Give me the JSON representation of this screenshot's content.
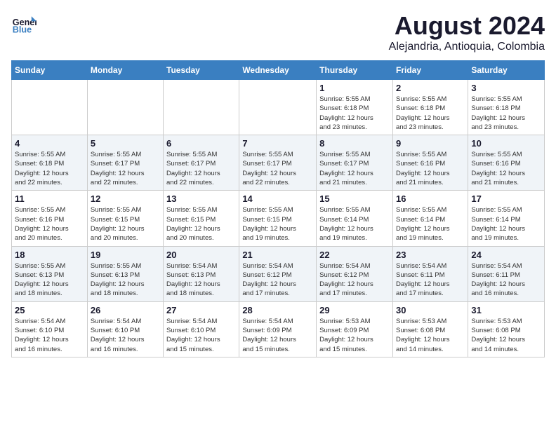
{
  "logo": {
    "text_general": "General",
    "text_blue": "Blue"
  },
  "title": "August 2024",
  "subtitle": "Alejandria, Antioquia, Colombia",
  "days_of_week": [
    "Sunday",
    "Monday",
    "Tuesday",
    "Wednesday",
    "Thursday",
    "Friday",
    "Saturday"
  ],
  "weeks": [
    [
      {
        "day": "",
        "info": ""
      },
      {
        "day": "",
        "info": ""
      },
      {
        "day": "",
        "info": ""
      },
      {
        "day": "",
        "info": ""
      },
      {
        "day": "1",
        "info": "Sunrise: 5:55 AM\nSunset: 6:18 PM\nDaylight: 12 hours\nand 23 minutes."
      },
      {
        "day": "2",
        "info": "Sunrise: 5:55 AM\nSunset: 6:18 PM\nDaylight: 12 hours\nand 23 minutes."
      },
      {
        "day": "3",
        "info": "Sunrise: 5:55 AM\nSunset: 6:18 PM\nDaylight: 12 hours\nand 23 minutes."
      }
    ],
    [
      {
        "day": "4",
        "info": "Sunrise: 5:55 AM\nSunset: 6:18 PM\nDaylight: 12 hours\nand 22 minutes."
      },
      {
        "day": "5",
        "info": "Sunrise: 5:55 AM\nSunset: 6:17 PM\nDaylight: 12 hours\nand 22 minutes."
      },
      {
        "day": "6",
        "info": "Sunrise: 5:55 AM\nSunset: 6:17 PM\nDaylight: 12 hours\nand 22 minutes."
      },
      {
        "day": "7",
        "info": "Sunrise: 5:55 AM\nSunset: 6:17 PM\nDaylight: 12 hours\nand 22 minutes."
      },
      {
        "day": "8",
        "info": "Sunrise: 5:55 AM\nSunset: 6:17 PM\nDaylight: 12 hours\nand 21 minutes."
      },
      {
        "day": "9",
        "info": "Sunrise: 5:55 AM\nSunset: 6:16 PM\nDaylight: 12 hours\nand 21 minutes."
      },
      {
        "day": "10",
        "info": "Sunrise: 5:55 AM\nSunset: 6:16 PM\nDaylight: 12 hours\nand 21 minutes."
      }
    ],
    [
      {
        "day": "11",
        "info": "Sunrise: 5:55 AM\nSunset: 6:16 PM\nDaylight: 12 hours\nand 20 minutes."
      },
      {
        "day": "12",
        "info": "Sunrise: 5:55 AM\nSunset: 6:15 PM\nDaylight: 12 hours\nand 20 minutes."
      },
      {
        "day": "13",
        "info": "Sunrise: 5:55 AM\nSunset: 6:15 PM\nDaylight: 12 hours\nand 20 minutes."
      },
      {
        "day": "14",
        "info": "Sunrise: 5:55 AM\nSunset: 6:15 PM\nDaylight: 12 hours\nand 19 minutes."
      },
      {
        "day": "15",
        "info": "Sunrise: 5:55 AM\nSunset: 6:14 PM\nDaylight: 12 hours\nand 19 minutes."
      },
      {
        "day": "16",
        "info": "Sunrise: 5:55 AM\nSunset: 6:14 PM\nDaylight: 12 hours\nand 19 minutes."
      },
      {
        "day": "17",
        "info": "Sunrise: 5:55 AM\nSunset: 6:14 PM\nDaylight: 12 hours\nand 19 minutes."
      }
    ],
    [
      {
        "day": "18",
        "info": "Sunrise: 5:55 AM\nSunset: 6:13 PM\nDaylight: 12 hours\nand 18 minutes."
      },
      {
        "day": "19",
        "info": "Sunrise: 5:55 AM\nSunset: 6:13 PM\nDaylight: 12 hours\nand 18 minutes."
      },
      {
        "day": "20",
        "info": "Sunrise: 5:54 AM\nSunset: 6:13 PM\nDaylight: 12 hours\nand 18 minutes."
      },
      {
        "day": "21",
        "info": "Sunrise: 5:54 AM\nSunset: 6:12 PM\nDaylight: 12 hours\nand 17 minutes."
      },
      {
        "day": "22",
        "info": "Sunrise: 5:54 AM\nSunset: 6:12 PM\nDaylight: 12 hours\nand 17 minutes."
      },
      {
        "day": "23",
        "info": "Sunrise: 5:54 AM\nSunset: 6:11 PM\nDaylight: 12 hours\nand 17 minutes."
      },
      {
        "day": "24",
        "info": "Sunrise: 5:54 AM\nSunset: 6:11 PM\nDaylight: 12 hours\nand 16 minutes."
      }
    ],
    [
      {
        "day": "25",
        "info": "Sunrise: 5:54 AM\nSunset: 6:10 PM\nDaylight: 12 hours\nand 16 minutes."
      },
      {
        "day": "26",
        "info": "Sunrise: 5:54 AM\nSunset: 6:10 PM\nDaylight: 12 hours\nand 16 minutes."
      },
      {
        "day": "27",
        "info": "Sunrise: 5:54 AM\nSunset: 6:10 PM\nDaylight: 12 hours\nand 15 minutes."
      },
      {
        "day": "28",
        "info": "Sunrise: 5:54 AM\nSunset: 6:09 PM\nDaylight: 12 hours\nand 15 minutes."
      },
      {
        "day": "29",
        "info": "Sunrise: 5:53 AM\nSunset: 6:09 PM\nDaylight: 12 hours\nand 15 minutes."
      },
      {
        "day": "30",
        "info": "Sunrise: 5:53 AM\nSunset: 6:08 PM\nDaylight: 12 hours\nand 14 minutes."
      },
      {
        "day": "31",
        "info": "Sunrise: 5:53 AM\nSunset: 6:08 PM\nDaylight: 12 hours\nand 14 minutes."
      }
    ]
  ]
}
